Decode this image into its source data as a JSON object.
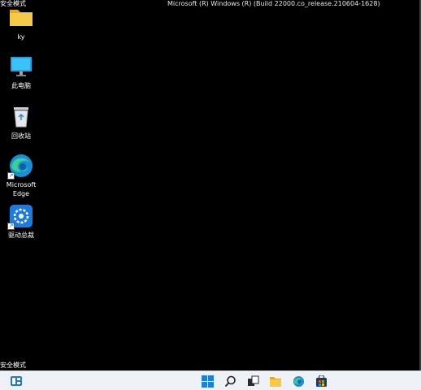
{
  "desktop": {
    "safe_mode_top": "安全模式",
    "safe_mode_bottom": "安全模式",
    "build_info": "Microsoft (R) Windows (R) (Build 22000.co_release.210604-1628)",
    "icons": [
      {
        "label": "ky",
        "icon": "folder-icon"
      },
      {
        "label": "此电脑",
        "icon": "computer-icon"
      },
      {
        "label": "回收站",
        "icon": "recycle-bin-icon"
      },
      {
        "label": "Microsoft\nEdge",
        "icon": "edge-icon"
      },
      {
        "label": "驱动总裁",
        "icon": "driver-tool-icon"
      }
    ]
  },
  "taskbar": {
    "items": [
      "widgets-icon",
      "start-icon",
      "search-icon",
      "task-view-icon",
      "file-explorer-icon",
      "edge-icon",
      "store-icon"
    ]
  },
  "colors": {
    "accent": "#0078d4",
    "desktop_bg": "#000000",
    "taskbar_bg": "#eef1f6"
  }
}
